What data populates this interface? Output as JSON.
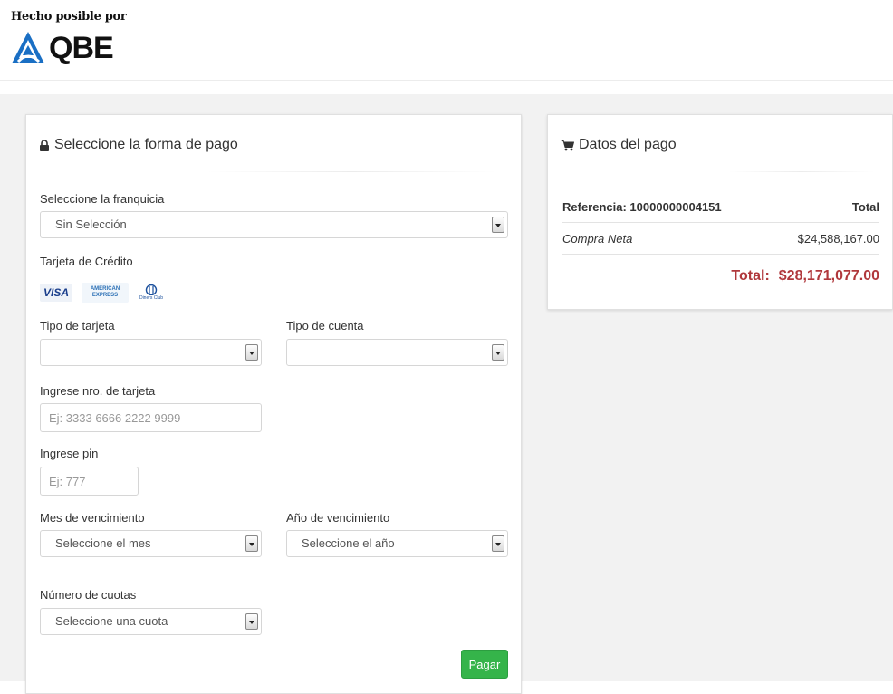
{
  "header": {
    "tagline": "Hecho posible por",
    "brand_name": "QBE",
    "brand_color": "#1a6fc4"
  },
  "payment": {
    "title": "Seleccione la forma de pago",
    "title_icon": "lock-icon",
    "franchise": {
      "label": "Seleccione la franquicia",
      "selected": "Sin Selección"
    },
    "credit_card": {
      "label": "Tarjeta de Crédito",
      "brands": [
        "VISA",
        "AMERICAN EXPRESS",
        "Diners Club"
      ]
    },
    "card_type": {
      "label": "Tipo de tarjeta",
      "selected": ""
    },
    "account_type": {
      "label": "Tipo de cuenta",
      "selected": ""
    },
    "card_number": {
      "label": "Ingrese nro. de tarjeta",
      "placeholder": "Ej: 3333 6666 2222 9999",
      "value": ""
    },
    "pin": {
      "label": "Ingrese pin",
      "placeholder": "Ej: 777",
      "value": ""
    },
    "exp_month": {
      "label": "Mes de vencimiento",
      "selected": "Seleccione el mes"
    },
    "exp_year": {
      "label": "Año de vencimiento",
      "selected": "Seleccione el año"
    },
    "installments": {
      "label": "Número de cuotas",
      "selected": "Seleccione una cuota"
    },
    "pay_button": "Pagar",
    "pay_button_color": "#35b44a"
  },
  "summary": {
    "title": "Datos del pago",
    "title_icon": "cart-icon",
    "reference_label": "Referencia: 10000000004151",
    "total_header": "Total",
    "lines": [
      {
        "item": "Compra Neta",
        "amount": "$24,588,167.00"
      }
    ],
    "grand_total_label": "Total:",
    "grand_total_value": "$28,171,077.00",
    "total_color": "#b0383c"
  }
}
